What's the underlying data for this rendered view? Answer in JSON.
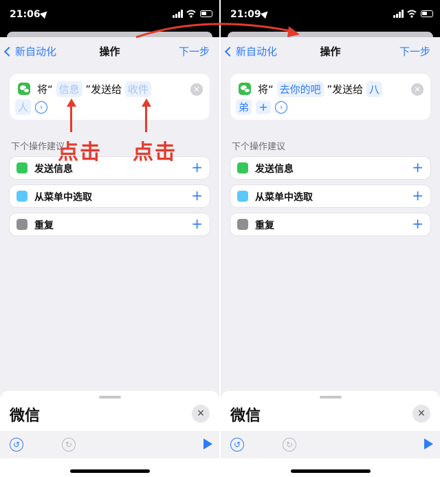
{
  "colors": {
    "accent": "#2f7cf6",
    "annotation": "#e53b2c",
    "wechat": "#3dbb4d"
  },
  "left": {
    "status_time": "21:06",
    "nav": {
      "back": "新自动化",
      "title": "操作",
      "next": "下一步"
    },
    "action": {
      "prefix": "将“",
      "message": "信息",
      "middle": "”发送给",
      "recipient_line1": "收件",
      "recipient_line2": "人"
    },
    "section_label": "下个操作建议",
    "suggestions": [
      {
        "label": "发送信息",
        "icon": "message-icon",
        "color": "#34c759"
      },
      {
        "label": "从菜单中选取",
        "icon": "menu-icon",
        "color": "#5ac8fa"
      },
      {
        "label": "重复",
        "icon": "repeat-icon",
        "color": "#8e8e93"
      }
    ],
    "sheet_title": "微信",
    "annotations": [
      "点击",
      "点击"
    ]
  },
  "right": {
    "status_time": "21:09",
    "nav": {
      "back": "新自动化",
      "title": "操作",
      "next": "下一步"
    },
    "action": {
      "prefix": "将“",
      "message": "去你的吧",
      "middle": "”发送给",
      "recipient_line1": "八",
      "recipient_line2": "弟"
    },
    "section_label": "下个操作建议",
    "suggestions": [
      {
        "label": "发送信息",
        "icon": "message-icon",
        "color": "#34c759"
      },
      {
        "label": "从菜单中选取",
        "icon": "menu-icon",
        "color": "#5ac8fa"
      },
      {
        "label": "重复",
        "icon": "repeat-icon",
        "color": "#8e8e93"
      }
    ],
    "sheet_title": "微信"
  }
}
